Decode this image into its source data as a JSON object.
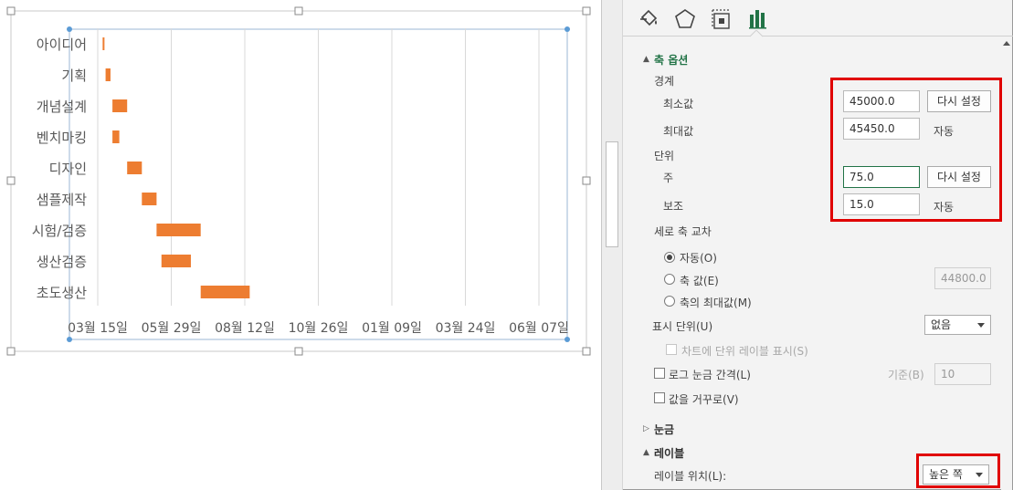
{
  "chart_data": {
    "type": "bar",
    "subtype": "gantt",
    "categories": [
      "아이디어",
      "기획",
      "개념설계",
      "벤치마킹",
      "디자인",
      "샘플제작",
      "시험/검증",
      "생산검증",
      "초도생산"
    ],
    "series": [
      {
        "start": [
          45005,
          45008,
          45015,
          45015,
          45030,
          45045,
          45060,
          45065,
          45105
        ],
        "end": [
          45006,
          45013,
          45030,
          45022,
          45045,
          45060,
          45105,
          45095,
          45155
        ]
      }
    ],
    "xlim": [
      45000,
      45180
    ],
    "x_ticks": [
      45000,
      45075,
      45150,
      45225,
      45300,
      45375,
      45450
    ],
    "x_tick_labels": [
      "03월 15일",
      "05월 29일",
      "08월 12일",
      "10월 26일",
      "01월 09일",
      "03월 24일",
      "06월 07일"
    ],
    "bar_color": "#ED7D31",
    "gridlines": "vertical"
  },
  "pane": {
    "tabs": [
      {
        "name": "fill-line",
        "icon": "paint-bucket-icon"
      },
      {
        "name": "effects",
        "icon": "pentagon-icon"
      },
      {
        "name": "size-properties",
        "icon": "size-properties-icon"
      },
      {
        "name": "axis-options",
        "icon": "bar-chart-icon",
        "active": true
      }
    ],
    "axis_options": {
      "title": "축 옵션",
      "bounds_title": "경계",
      "min_label": "최소값",
      "min_value": "45000.0",
      "min_button": "다시 설정",
      "max_label": "최대값",
      "max_value": "45450.0",
      "max_state": "자동",
      "units_title": "단위",
      "major_label": "주",
      "major_value": "75.0",
      "major_button": "다시 설정",
      "minor_label": "보조",
      "minor_value": "15.0",
      "minor_state": "자동",
      "cross_title": "세로 축 교차",
      "cross_auto": "자동(O)",
      "cross_value_label": "축 값(E)",
      "cross_value": "44800.0",
      "cross_max": "축의 최대값(M)",
      "display_units_label": "표시 단위(U)",
      "display_units_value": "없음",
      "show_units_label": "차트에 단위 레이블 표시(S)",
      "log_scale_label": "로그 눈금 간격(L)",
      "log_base_label": "기준(B)",
      "log_base_value": "10",
      "reverse_label": "값을 거꾸로(V)"
    },
    "ticks_title": "눈금",
    "labels_title": "레이블",
    "label_position_label": "레이블 위치(L):",
    "label_position_value": "높은 쪽"
  },
  "colors": {
    "accent_green": "#217346",
    "highlight_red": "#E00000",
    "bar_orange": "#ED7D31"
  }
}
